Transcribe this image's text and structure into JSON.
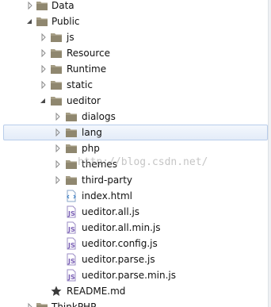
{
  "tree": {
    "items": [
      {
        "name": "Data",
        "type": "folder",
        "expanded": false
      },
      {
        "name": "Public",
        "type": "folder",
        "expanded": true
      },
      {
        "name": "js",
        "type": "folder",
        "expanded": false
      },
      {
        "name": "Resource",
        "type": "folder",
        "expanded": false
      },
      {
        "name": "Runtime",
        "type": "folder",
        "expanded": false
      },
      {
        "name": "static",
        "type": "folder",
        "expanded": false
      },
      {
        "name": "ueditor",
        "type": "folder",
        "expanded": true
      },
      {
        "name": "dialogs",
        "type": "folder",
        "expanded": false
      },
      {
        "name": "lang",
        "type": "folder",
        "expanded": false,
        "selected": true
      },
      {
        "name": "php",
        "type": "folder",
        "expanded": false
      },
      {
        "name": "themes",
        "type": "folder",
        "expanded": false
      },
      {
        "name": "third-party",
        "type": "folder",
        "expanded": false
      },
      {
        "name": "index.html",
        "type": "html-file"
      },
      {
        "name": "ueditor.all.js",
        "type": "js-file"
      },
      {
        "name": "ueditor.all.min.js",
        "type": "js-file"
      },
      {
        "name": "ueditor.config.js",
        "type": "js-file"
      },
      {
        "name": "ueditor.parse.js",
        "type": "js-file"
      },
      {
        "name": "ueditor.parse.min.js",
        "type": "js-file"
      },
      {
        "name": "README.md",
        "type": "readme-file"
      },
      {
        "name": "ThinkPHP",
        "type": "folder",
        "expanded": false
      }
    ]
  },
  "watermark": {
    "text": "http://blog.csdn.net/"
  },
  "colors": {
    "folder": "#9a9179",
    "folder_dark": "#7d7563",
    "selection_border": "#b9cdea",
    "selection_fill": "#e4ecf8",
    "html_icon": "#3d7fc4",
    "js_icon": "#7a5fb5"
  },
  "icons": {
    "folder": "folder-icon",
    "html-file": "html-file-icon",
    "js-file": "js-file-icon",
    "readme-file": "readme-star-icon",
    "collapsed": "chevron-right-icon",
    "expanded": "triangle-down-icon"
  }
}
